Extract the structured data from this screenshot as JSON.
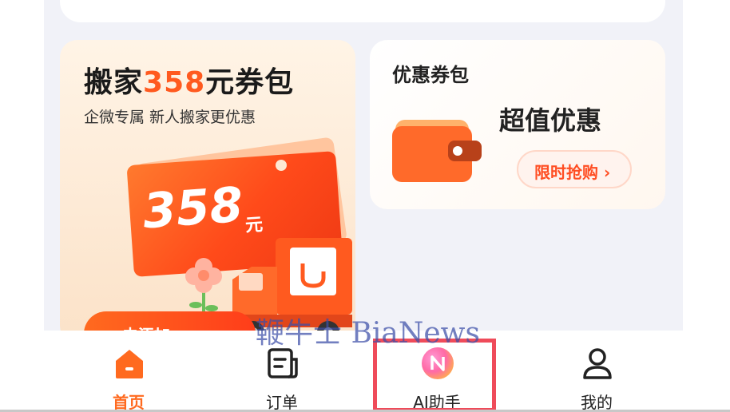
{
  "promo": {
    "title_pre": "搬家",
    "title_amount": "358",
    "title_post": "元券包",
    "subtitle": "企微专属 新人搬家更优惠",
    "ticket_amount": "358",
    "ticket_unit": "元",
    "button_label": "去添加 ›"
  },
  "coupon": {
    "title": "优惠券包",
    "headline": "超值优惠",
    "button_label": "限时抢购 ›"
  },
  "tabbar": {
    "items": [
      {
        "label": "首页",
        "icon": "home-icon",
        "active": true
      },
      {
        "label": "订单",
        "icon": "orders-icon"
      },
      {
        "label": "AI助手",
        "icon": "ai-assistant-icon"
      },
      {
        "label": "我的",
        "icon": "profile-icon"
      }
    ]
  },
  "watermark": "鞭牛士 BiaNews",
  "colors": {
    "accent": "#ff6a1f",
    "highlight": "#ef4b5a",
    "background": "#f1f2f8"
  }
}
